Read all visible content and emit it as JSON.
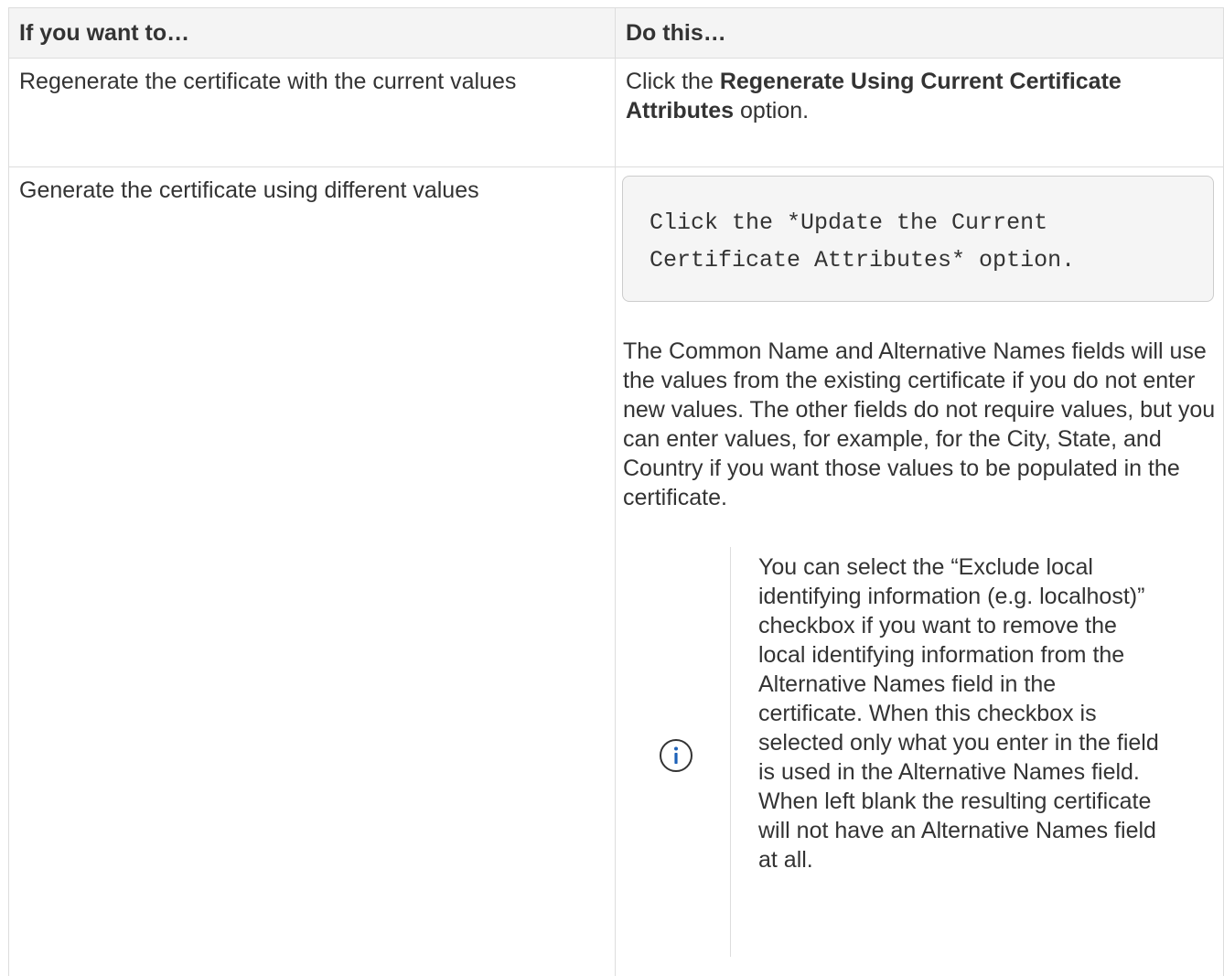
{
  "table": {
    "headers": [
      "If you want to…",
      "Do this…"
    ],
    "row1": {
      "want": "Regenerate the certificate with the current values",
      "do_prefix": "Click the ",
      "do_bold": "Regenerate Using Current Certificate Attributes",
      "do_suffix": " option."
    },
    "row2": {
      "want": "Generate the certificate using different values",
      "code": "Click the *Update the Current\nCertificate Attributes* option.",
      "paragraph": "The Common Name and Alternative Names fields will use the values from the existing certificate if you do not enter new values. The other fields do not require values, but you can enter values, for example, for the City, State, and Country if you want those values to be populated in the certificate.",
      "note": {
        "icon": "info-icon",
        "text": "You can select the “Exclude local identifying information (e.g. localhost)” checkbox if you want to remove the local identifying information from the Alternative Names field in the certificate. When this checkbox is selected only what you enter in the field is used in the Alternative Names field. When left blank the resulting certificate will not have an Alternative Names field at all."
      }
    }
  },
  "colors": {
    "text": "#333333",
    "header_bg": "#f4f4f4",
    "border": "#dddddd",
    "code_bg": "#f5f5f5",
    "info_icon": "#1d61b8"
  }
}
